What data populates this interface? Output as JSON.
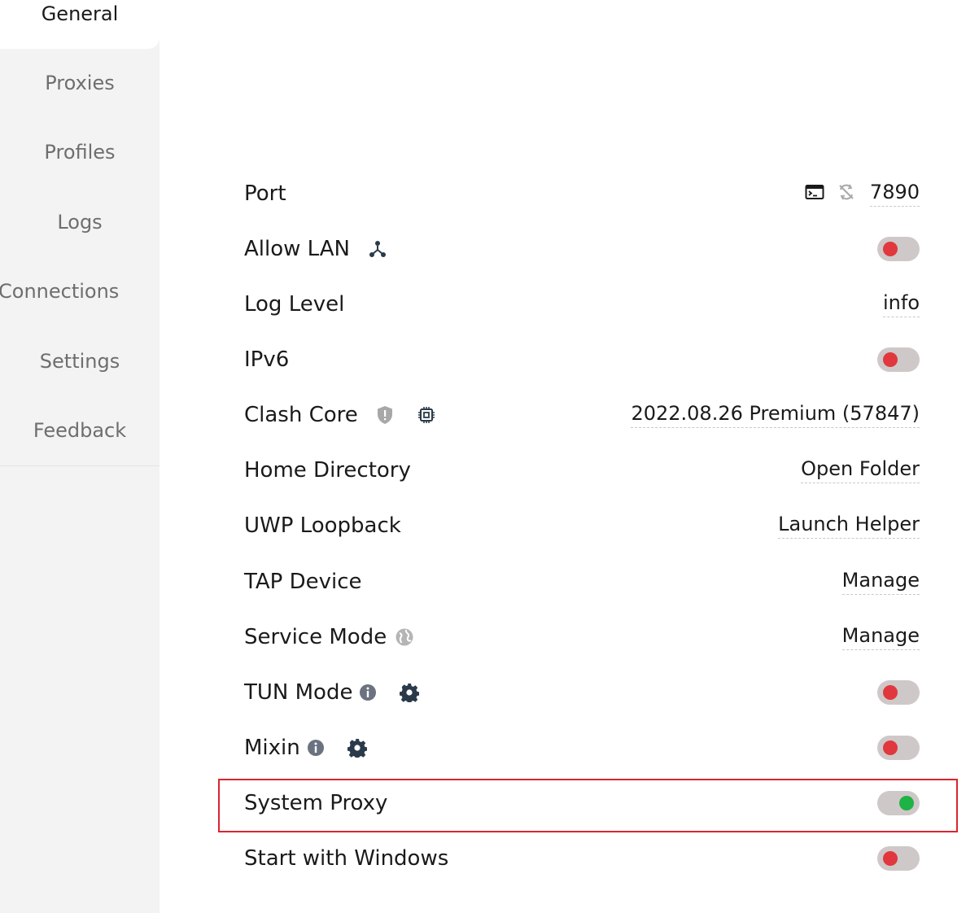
{
  "sidebar": {
    "items": [
      {
        "label": "General",
        "active": true
      },
      {
        "label": "Proxies"
      },
      {
        "label": "Profiles"
      },
      {
        "label": "Logs"
      },
      {
        "label": "Connections"
      },
      {
        "label": "Settings"
      },
      {
        "label": "Feedback"
      }
    ]
  },
  "settings": {
    "port": {
      "label": "Port",
      "value": "7890",
      "icons": [
        "terminal-icon",
        "network-sync-off-icon"
      ]
    },
    "allow_lan": {
      "label": "Allow LAN",
      "enabled": false,
      "icon": "lan-icon"
    },
    "log_level": {
      "label": "Log Level",
      "value": "info"
    },
    "ipv6": {
      "label": "IPv6",
      "enabled": false
    },
    "clash_core": {
      "label": "Clash Core",
      "value": "2022.08.26 Premium (57847)",
      "icons": [
        "shield-icon",
        "chip-icon"
      ]
    },
    "home_directory": {
      "label": "Home Directory",
      "value": "Open Folder"
    },
    "uwp_loopback": {
      "label": "UWP Loopback",
      "value": "Launch Helper"
    },
    "tap_device": {
      "label": "TAP Device",
      "value": "Manage"
    },
    "service_mode": {
      "label": "Service Mode",
      "value": "Manage",
      "icon": "globe-icon"
    },
    "tun_mode": {
      "label": "TUN Mode",
      "enabled": false,
      "icons": [
        "info-icon",
        "gear-icon"
      ]
    },
    "mixin": {
      "label": "Mixin",
      "enabled": false,
      "icons": [
        "info-icon",
        "gear-icon"
      ]
    },
    "system_proxy": {
      "label": "System Proxy",
      "enabled": true,
      "highlighted": true
    },
    "start_with_windows": {
      "label": "Start with Windows",
      "enabled": false
    }
  },
  "colors": {
    "toggle_off_knob": "#e0383e",
    "toggle_on_knob": "#1fb245",
    "toggle_track": "#cfc8c8",
    "highlight_border": "#d9262f",
    "sidebar_bg": "#f3f3f3"
  }
}
